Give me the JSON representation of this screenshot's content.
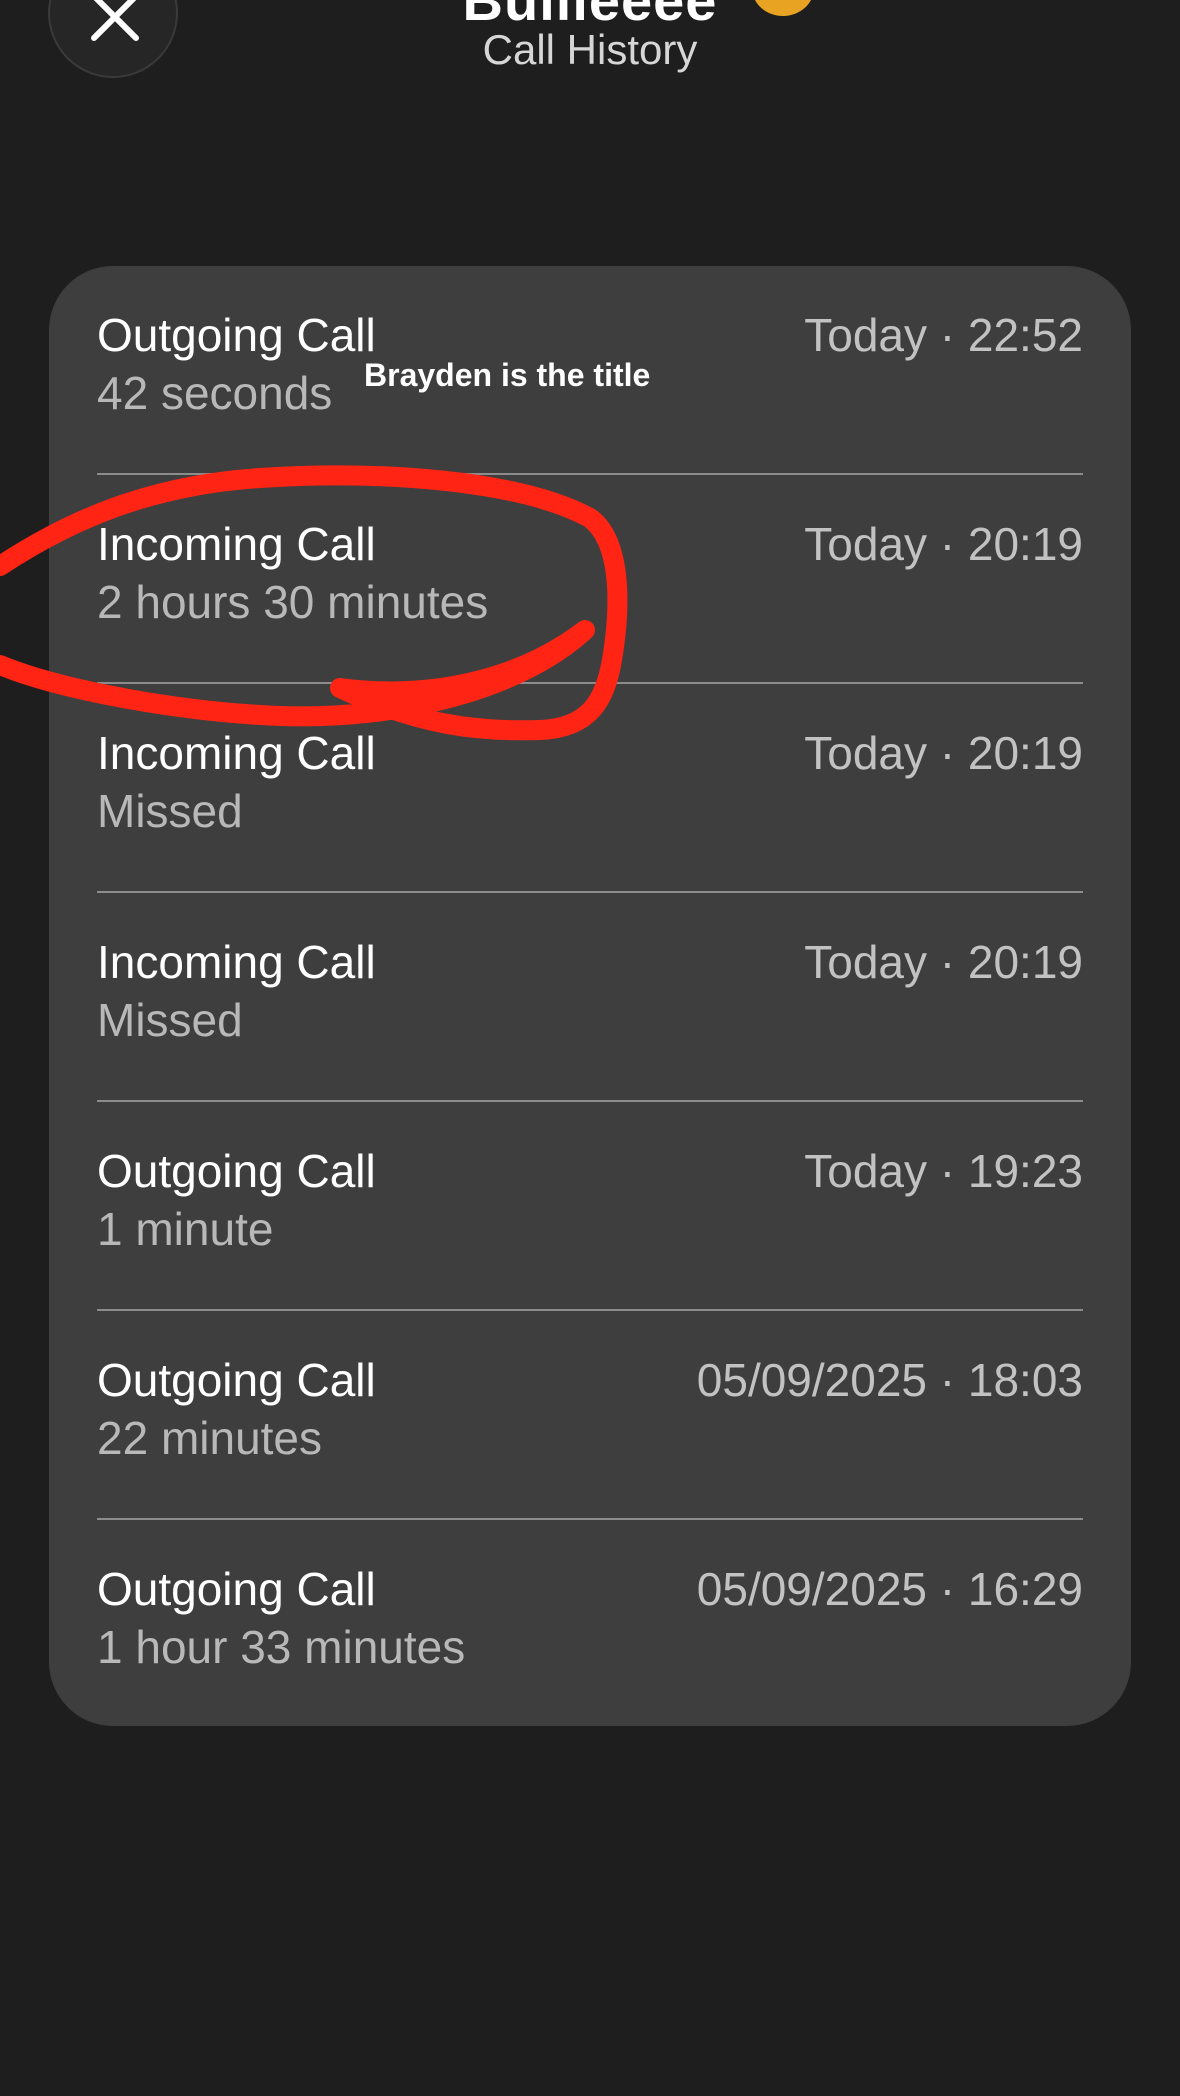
{
  "header": {
    "title": "Bullieeee",
    "subtitle": "Call History",
    "close_icon": "close-icon"
  },
  "calls": [
    {
      "type": "Outgoing Call",
      "detail": "42 seconds",
      "time": "Today · 22:52"
    },
    {
      "type": "Incoming Call",
      "detail": "2 hours 30 minutes",
      "time": "Today · 20:19"
    },
    {
      "type": "Incoming Call",
      "detail": "Missed",
      "time": "Today · 20:19"
    },
    {
      "type": "Incoming Call",
      "detail": "Missed",
      "time": "Today · 20:19"
    },
    {
      "type": "Outgoing Call",
      "detail": "1 minute",
      "time": "Today · 19:23"
    },
    {
      "type": "Outgoing Call",
      "detail": "22 minutes",
      "time": "05/09/2025 · 18:03"
    },
    {
      "type": "Outgoing Call",
      "detail": "1 hour 33 minutes",
      "time": "05/09/2025 · 16:29"
    }
  ],
  "overlay": {
    "caption": "Brayden is the title",
    "annotation_color": "#ff2414"
  },
  "colors": {
    "background": "#1e1e1e",
    "card": "#3e3e3e",
    "divider": "#8c8c8c",
    "secondary_text": "#b8b8b8"
  }
}
